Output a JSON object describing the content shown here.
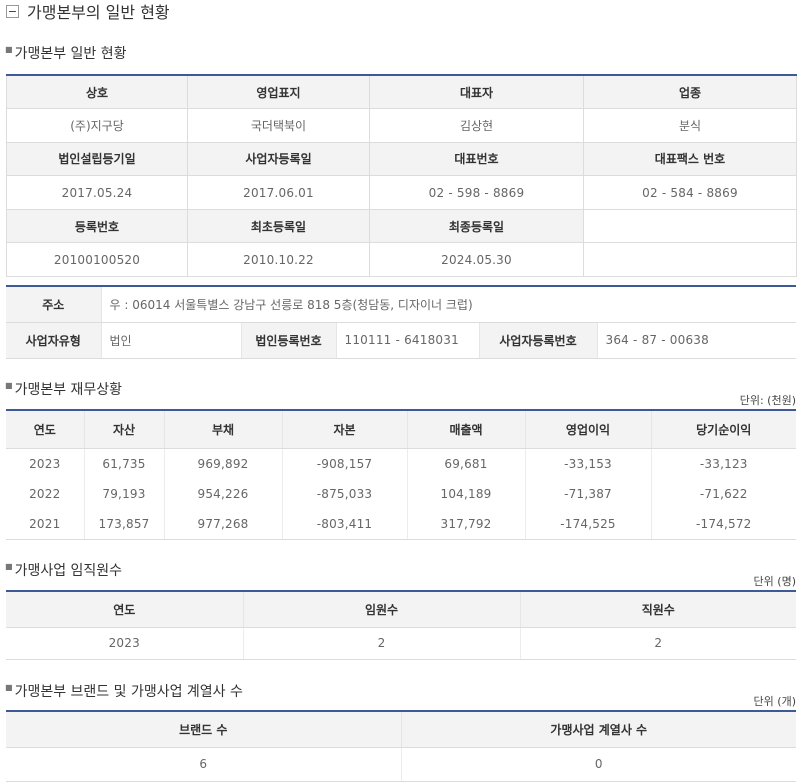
{
  "page_title": "가맹본부의 일반 현황",
  "toggle_symbol": "−",
  "section1": {
    "title": "가맹본부 일반 현황",
    "headers1": [
      "상호",
      "영업표지",
      "대표자",
      "업종"
    ],
    "row1": [
      "(주)지구당",
      "국더택북이",
      "김상현",
      "분식"
    ],
    "headers2": [
      "법인설립등기일",
      "사업자등록일",
      "대표번호",
      "대표팩스 번호"
    ],
    "row2": [
      "2017.05.24",
      "2017.06.01",
      "02 - 598 - 8869",
      "02 - 584 - 8869"
    ],
    "headers3": [
      "등록번호",
      "최초등록일",
      "최종등록일",
      ""
    ],
    "row3": [
      "20100100520",
      "2010.10.22",
      "2024.05.30",
      ""
    ]
  },
  "address_block": {
    "address_label": "주소",
    "address_value": "우 : 06014 서울특별스 강남구 선릉로 818 5층(청담동, 디자이너 크럽)",
    "biz_type_label": "사업자유형",
    "biz_type_value": "법인",
    "corp_no_label": "법인등록번호",
    "corp_no_value": "110111 - 6418031",
    "biz_no_label": "사업자등록번호",
    "biz_no_value": "364 - 87 - 00638"
  },
  "section2": {
    "title": "가맹본부 재무상황",
    "unit": "단위: (천원)",
    "headers": [
      "연도",
      "자산",
      "부채",
      "자본",
      "매출액",
      "영업이익",
      "당기순이익"
    ],
    "rows": [
      [
        "2023",
        "61,735",
        "969,892",
        "-908,157",
        "69,681",
        "-33,153",
        "-33,123"
      ],
      [
        "2022",
        "79,193",
        "954,226",
        "-875,033",
        "104,189",
        "-71,387",
        "-71,622"
      ],
      [
        "2021",
        "173,857",
        "977,268",
        "-803,411",
        "317,792",
        "-174,525",
        "-174,572"
      ]
    ]
  },
  "section3": {
    "title": "가맹사업 임직원수",
    "unit": "단위 (명)",
    "headers": [
      "연도",
      "임원수",
      "직원수"
    ],
    "rows": [
      [
        "2023",
        "2",
        "2"
      ]
    ]
  },
  "section4": {
    "title": "가맹본부 브랜드 및 가맹사업 계열사 수",
    "unit": "단위 (개)",
    "headers": [
      "브랜드 수",
      "가맹사업 계열사 수"
    ],
    "rows": [
      [
        "6",
        "0"
      ]
    ]
  },
  "colors": {
    "accent_border": "#3d5a97",
    "header_bg": "#f3f3f3"
  }
}
